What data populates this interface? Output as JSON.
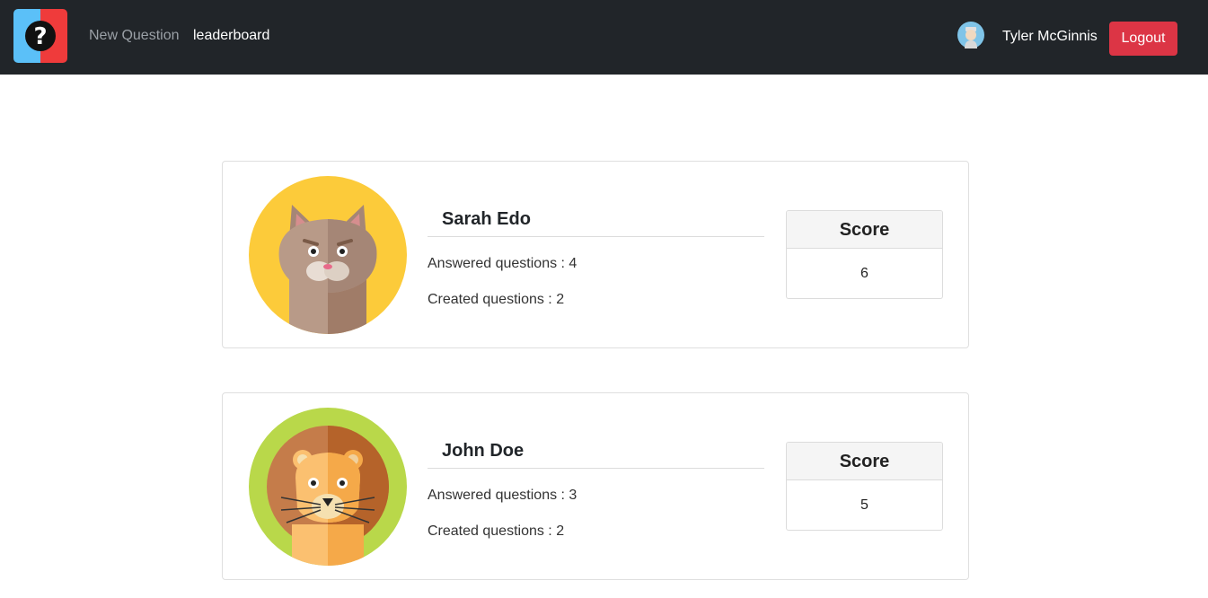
{
  "nav": {
    "logo_icon": "question-mark-logo-icon",
    "links": [
      "New Question",
      "leaderboard"
    ],
    "user": {
      "name": "Tyler McGinnis",
      "avatar_icon": "tyler-mcginnis-avatar-icon"
    },
    "logout_label": "Logout"
  },
  "leaderboard": [
    {
      "name": "Sarah Edo",
      "avatar_icon": "cat-avatar-icon",
      "answered": "Answered questions : 4",
      "created": "Created questions : 2",
      "score_label": "Score",
      "score": "6"
    },
    {
      "name": "John Doe",
      "avatar_icon": "lion-avatar-icon",
      "answered": "Answered questions : 3",
      "created": "Created questions : 2",
      "score_label": "Score",
      "score": "5"
    }
  ],
  "colors": {
    "navbar": "#212529",
    "logout": "#dc3545",
    "logo_left": "#5bc0f8",
    "logo_right": "#ef3b3b",
    "cat_bg": "#fccb3a",
    "lion_bg": "#b9d84a"
  }
}
